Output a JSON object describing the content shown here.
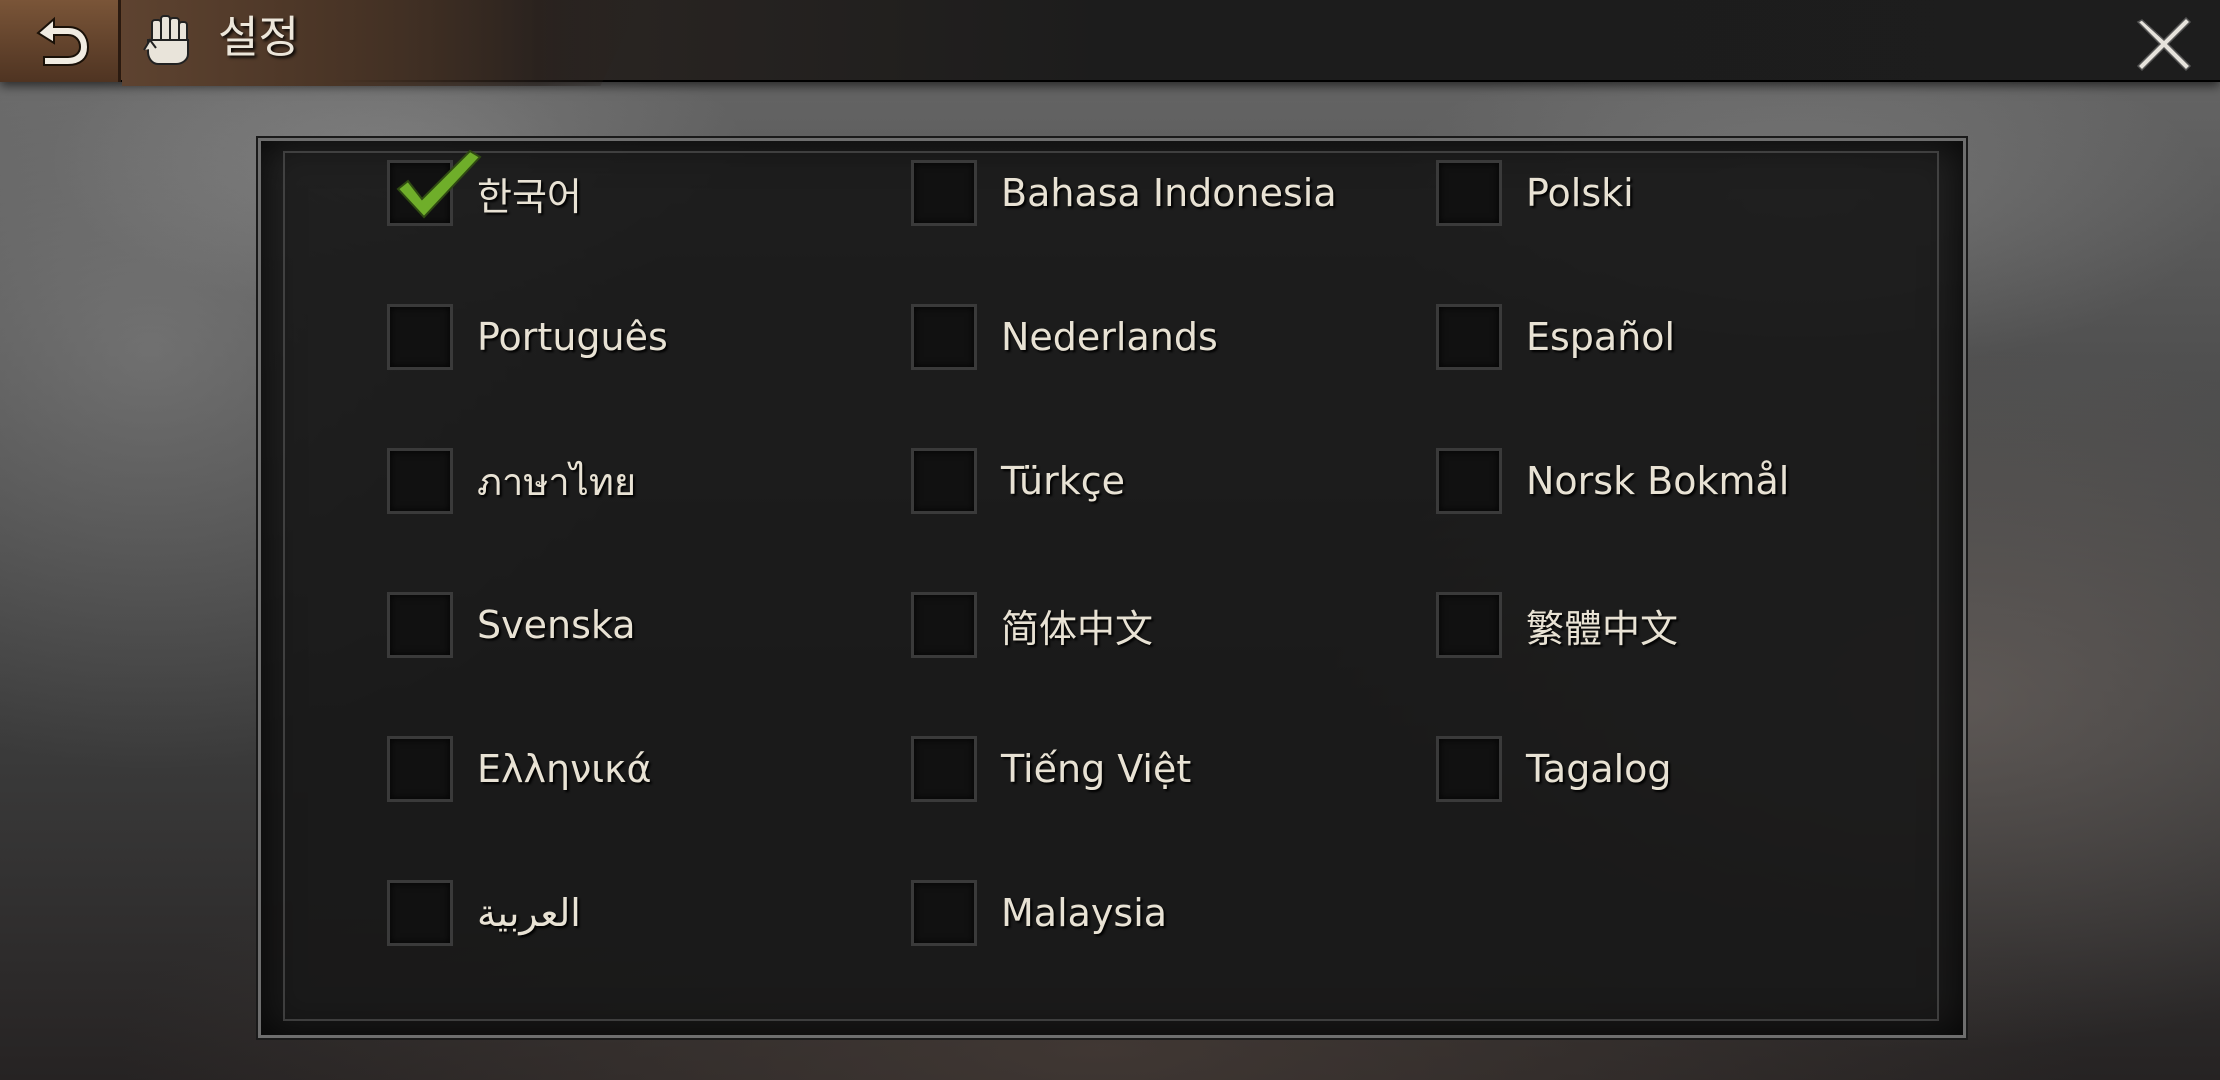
{
  "header": {
    "title": "설정",
    "back_icon": "back-arrow-icon",
    "settings_icon": "fist-icon",
    "close_icon": "close-icon"
  },
  "languages": [
    {
      "label": "한국어",
      "checked": true
    },
    {
      "label": "Bahasa Indonesia",
      "checked": false
    },
    {
      "label": "Polski",
      "checked": false
    },
    {
      "label": "Português",
      "checked": false
    },
    {
      "label": "Nederlands",
      "checked": false
    },
    {
      "label": "Español",
      "checked": false
    },
    {
      "label": "ภาษาไทย",
      "checked": false
    },
    {
      "label": "Türkçe",
      "checked": false
    },
    {
      "label": "Norsk Bokmål",
      "checked": false
    },
    {
      "label": "Svenska",
      "checked": false
    },
    {
      "label": "简体中文",
      "checked": false
    },
    {
      "label": "繁體中文",
      "checked": false
    },
    {
      "label": "Ελληνικά",
      "checked": false
    },
    {
      "label": "Tiếng Việt",
      "checked": false
    },
    {
      "label": "Tagalog",
      "checked": false
    },
    {
      "label": "العربية",
      "checked": false
    },
    {
      "label": "Malaysia",
      "checked": false
    }
  ],
  "colors": {
    "accent_check": "#6fae2a",
    "label_text": "#e8e2d4",
    "header_wood": "#6b4a32"
  }
}
